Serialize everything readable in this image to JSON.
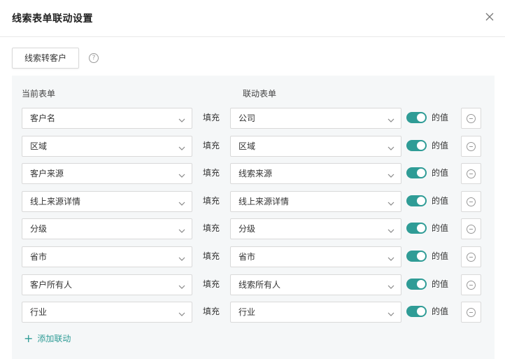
{
  "dialog": {
    "title": "线索表单联动设置",
    "close_icon": "close-icon"
  },
  "tab": {
    "label": "线索转客户",
    "help_icon": "question-circle-icon"
  },
  "columns": {
    "current": "当前表单",
    "linked": "联动表单"
  },
  "fill_label": "填充",
  "value_label": "的值",
  "rows": [
    {
      "source": "客户名",
      "target": "公司",
      "enabled": true
    },
    {
      "source": "区域",
      "target": "区域",
      "enabled": true
    },
    {
      "source": "客户来源",
      "target": "线索来源",
      "enabled": true
    },
    {
      "source": "线上来源详情",
      "target": "线上来源详情",
      "enabled": true
    },
    {
      "source": "分级",
      "target": "分级",
      "enabled": true
    },
    {
      "source": "省市",
      "target": "省市",
      "enabled": true
    },
    {
      "source": "客户所有人",
      "target": "线索所有人",
      "enabled": true
    },
    {
      "source": "行业",
      "target": "行业",
      "enabled": true
    }
  ],
  "add_link": {
    "label": "添加联动",
    "icon": "plus-icon"
  },
  "colors": {
    "accent": "#2f9c96",
    "panel_bg": "#f5f7f8",
    "border": "#d9d9d9"
  }
}
